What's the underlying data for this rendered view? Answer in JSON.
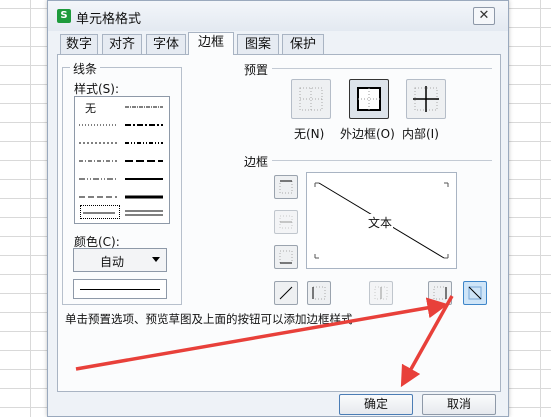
{
  "dialog": {
    "title": "单元格格式",
    "app_icon_letter": "S",
    "close_glyph": "✕"
  },
  "tabs": [
    {
      "label": "数字"
    },
    {
      "label": "对齐"
    },
    {
      "label": "字体"
    },
    {
      "label": "边框",
      "active": true
    },
    {
      "label": "图案"
    },
    {
      "label": "保护"
    }
  ],
  "line_group": {
    "title": "线条",
    "style_label": "样式(S):",
    "none_label": "无",
    "color_label": "颜色(C):",
    "color_value": "自动"
  },
  "presets": {
    "title": "预置",
    "items": [
      {
        "label": "无(N)"
      },
      {
        "label": "外边框(O)"
      },
      {
        "label": "内部(I)"
      }
    ]
  },
  "border": {
    "title": "边框",
    "preview_text": "文本"
  },
  "hint": "单击预置选项、预览草图及上面的按钮可以添加边框样式",
  "buttons": {
    "ok": "确定",
    "cancel": "取消"
  },
  "colors": {
    "accent": "#3f86c9",
    "arrow": "#e8403a",
    "app_icon": "#1e9b3c"
  }
}
